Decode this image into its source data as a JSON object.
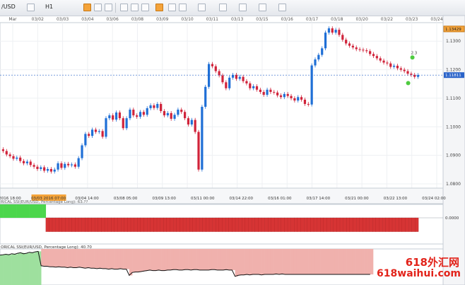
{
  "toolbar": {
    "symbol": "/USD",
    "timeframe": "H1",
    "buttons": [
      "dropdown-icon",
      "bar-chart-icon",
      "candle-icon",
      "line-chart-icon",
      "zoom-in-icon",
      "zoom-out-icon",
      "crosshair-icon",
      "draw-line-icon",
      "text-icon",
      "indicator-icon",
      "settings-icon",
      "template-icon",
      "print-icon",
      "save-icon",
      "refresh-icon"
    ]
  },
  "colors": {
    "bull": "#1f6fd6",
    "bear": "#d0233a",
    "osc_pos": "#4cd64c",
    "osc_neg": "#d63434",
    "area_pos": "#9ee09e",
    "area_neg": "#f0b1ad",
    "accent": "#f4a33a"
  },
  "chart_data": [
    {
      "type": "candlestick",
      "top_axis_labels": [
        "Mar",
        "03/02",
        "03/03",
        "03/04",
        "03/06",
        "03/08",
        "03/09",
        "03/10",
        "03/11",
        "03/13",
        "03/15",
        "03/16",
        "03/17",
        "03/18",
        "03/20",
        "03/22",
        "03/23",
        "03/24"
      ],
      "bottom_axis_labels": [
        "2016 18:00",
        "03/03 2016 07:00",
        "03/04 14:00",
        "03/08 05:00",
        "03/09 13:00",
        "03/11 00:00",
        "03/14 22:00",
        "03/16 01:00",
        "03/17 14:00",
        "03/21 00:00",
        "03/22 13:00",
        "03/24 02:00"
      ],
      "price_labels": [
        "1.1300",
        "1.1200",
        "1.1100",
        "1.1000",
        "1.0900",
        "1.0800"
      ],
      "ylim": [
        1.0785,
        1.1365
      ],
      "markers": {
        "high": "1.13429",
        "current": "1.11811",
        "signal": "2.3"
      },
      "values": [
        1.0915,
        1.0903,
        1.0897,
        1.0888,
        1.0892,
        1.088,
        1.0872,
        1.0878,
        1.0866,
        1.086,
        1.0852,
        1.0858,
        1.0846,
        1.0852,
        1.0843,
        1.085,
        1.0872,
        1.0856,
        1.087,
        1.0865,
        1.0868,
        1.086,
        1.089,
        1.0935,
        1.0975,
        1.0968,
        1.099,
        1.0982,
        1.0985,
        1.0965,
        1.103,
        1.104,
        1.1025,
        1.105,
        1.103,
        1.0995,
        1.103,
        1.106,
        1.104,
        1.1035,
        1.1052,
        1.1042,
        1.1065,
        1.1075,
        1.1066,
        1.108,
        1.1055,
        1.104,
        1.1048,
        1.1028,
        1.1042,
        1.106,
        1.1052,
        1.103,
        1.1008,
        1.1024,
        1.0982,
        1.085,
        1.107,
        1.114,
        1.122,
        1.1212,
        1.1195,
        1.118,
        1.1156,
        1.1135,
        1.1172,
        1.1182,
        1.1168,
        1.1175,
        1.116,
        1.1152,
        1.1135,
        1.1142,
        1.113,
        1.1122,
        1.1112,
        1.113,
        1.1122,
        1.112,
        1.111,
        1.1104,
        1.1115,
        1.1108,
        1.11,
        1.1092,
        1.1104,
        1.1095,
        1.108,
        1.1078,
        1.1215,
        1.1236,
        1.1252,
        1.1275,
        1.133,
        1.1345,
        1.133,
        1.134,
        1.1322,
        1.1305,
        1.1292,
        1.1284,
        1.1278,
        1.1272,
        1.127,
        1.1268,
        1.1265,
        1.1255,
        1.1248,
        1.124,
        1.1232,
        1.1225,
        1.1222,
        1.121,
        1.1214,
        1.1205,
        1.12,
        1.1195,
        1.1186,
        1.1182,
        1.1175,
        1.1181
      ]
    },
    {
      "type": "bar",
      "title": "RICAL SSI(EUR/USD, Percentage Long): 63.??",
      "axis_labels": [
        "0.0000"
      ],
      "values": [
        1.0,
        1.0,
        1.0,
        1.0,
        1.0,
        1.0,
        1.0,
        1.0,
        1.0,
        1.0,
        1.0,
        1.0,
        1.0,
        1.0,
        -0.7,
        -0.7,
        -0.7,
        -0.7,
        -0.7,
        -0.7,
        -0.7,
        -0.7,
        -0.7,
        -0.7,
        -0.7,
        -0.7,
        -0.7,
        -0.7,
        -0.7,
        -0.7,
        -0.7,
        -0.7,
        -0.7,
        -0.7,
        -0.7,
        -0.7,
        -0.7,
        -0.7,
        -0.7,
        -0.7,
        -0.7,
        -0.7,
        -0.7,
        -0.7,
        -0.7,
        -0.7,
        -0.7,
        -0.7,
        -0.7,
        -0.7,
        -0.7,
        -0.7,
        -0.7,
        -0.7,
        -0.7,
        -0.7,
        -0.7,
        -0.7,
        -0.7,
        -0.7,
        -0.7,
        -0.7,
        -0.7,
        -0.7,
        -0.7,
        -0.7,
        -0.7,
        -0.7,
        -0.7,
        -0.7,
        -0.7,
        -0.7,
        -0.7,
        -0.7,
        -0.7,
        -0.7,
        -0.7,
        -0.7,
        -0.7,
        -0.7,
        -0.7,
        -0.7,
        -0.7,
        -0.7,
        -0.7,
        -0.7,
        -0.7,
        -0.7,
        -0.7,
        -0.7,
        -0.7,
        -0.7,
        -0.7,
        -0.7,
        -0.7,
        -0.7,
        -0.7,
        -0.7,
        -0.7,
        -0.7,
        -0.7,
        -0.7,
        -0.7,
        -0.7,
        -0.7,
        -0.7,
        -0.7,
        -0.7,
        -0.7,
        -0.7,
        -0.7,
        -0.7,
        -0.7,
        -0.7,
        -0.7,
        -0.7,
        -0.7,
        -0.7,
        -0.7,
        -0.7,
        -0.7,
        -0.7,
        -0.7,
        -0.7,
        -0.7,
        -0.7,
        -0.7,
        -0.7
      ]
    },
    {
      "type": "area",
      "title": "ORICAL SSI(EUR/USD, Percentage Long): 40.70",
      "values": [
        62,
        63,
        64,
        63,
        65,
        64,
        66,
        67,
        65,
        66,
        68,
        67,
        69,
        70,
        40,
        39,
        39,
        38,
        38,
        37,
        38,
        37,
        37,
        36,
        37,
        36,
        36,
        37,
        36,
        35,
        36,
        35,
        35,
        34,
        35,
        34,
        34,
        33,
        34,
        33,
        33,
        34,
        33,
        33,
        20,
        26,
        27,
        27,
        28,
        29,
        30,
        31,
        30,
        30,
        31,
        30,
        30,
        31,
        31,
        32,
        32,
        31,
        31,
        32,
        32,
        31,
        32,
        32,
        31,
        31,
        31,
        31,
        32,
        32,
        31,
        31,
        31,
        32,
        31,
        31,
        18,
        20,
        21,
        21,
        22,
        21,
        22,
        22,
        22,
        21,
        22,
        22,
        22,
        22,
        23,
        22,
        23,
        22,
        22,
        22,
        22,
        22,
        22,
        22,
        22,
        22,
        22,
        22,
        22,
        22,
        22,
        22,
        22,
        22,
        22,
        22,
        22,
        22,
        22,
        22,
        22,
        22,
        22,
        22,
        22,
        22,
        22
      ]
    }
  ],
  "watermark": {
    "line1": "618外汇网",
    "line2": "618waihui.com"
  }
}
